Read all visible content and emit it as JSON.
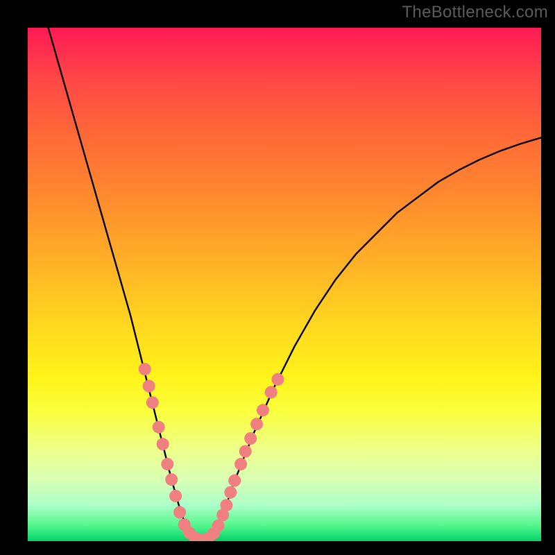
{
  "watermark": "TheBottleneck.com",
  "chart_data": {
    "type": "line",
    "title": "",
    "xlabel": "",
    "ylabel": "",
    "xlim": [
      0,
      100
    ],
    "ylim": [
      0,
      100
    ],
    "annotations": [],
    "series": [
      {
        "name": "bottleneck-curve",
        "x": [
          4,
          6,
          8,
          10,
          12,
          14,
          16,
          18,
          20,
          22,
          24,
          26,
          28,
          30,
          32,
          34,
          36,
          38,
          40,
          44,
          48,
          52,
          56,
          60,
          64,
          68,
          72,
          76,
          80,
          84,
          88,
          92,
          96,
          100
        ],
        "y": [
          100,
          93,
          86,
          79,
          72,
          65,
          58,
          51,
          44,
          36,
          28,
          20,
          12,
          5,
          1,
          0,
          1,
          5,
          11,
          21,
          30,
          38,
          45,
          51,
          56,
          60,
          64,
          67,
          70,
          72.3,
          74.3,
          76,
          77.4,
          78.6
        ]
      }
    ],
    "markers": {
      "name": "highlight-dots",
      "color": "#f08080",
      "points": [
        {
          "x": 22.8,
          "y": 33.5
        },
        {
          "x": 23.6,
          "y": 30.2
        },
        {
          "x": 24.3,
          "y": 27.0
        },
        {
          "x": 25.5,
          "y": 22.2
        },
        {
          "x": 26.3,
          "y": 18.9
        },
        {
          "x": 27.2,
          "y": 15.0
        },
        {
          "x": 28.0,
          "y": 12.0
        },
        {
          "x": 28.8,
          "y": 8.8
        },
        {
          "x": 29.6,
          "y": 5.6
        },
        {
          "x": 30.5,
          "y": 3.2
        },
        {
          "x": 31.5,
          "y": 1.6
        },
        {
          "x": 32.6,
          "y": 0.6
        },
        {
          "x": 33.9,
          "y": 0.2
        },
        {
          "x": 35.1,
          "y": 0.5
        },
        {
          "x": 36.2,
          "y": 1.5
        },
        {
          "x": 37.1,
          "y": 3.0
        },
        {
          "x": 38.0,
          "y": 5.1
        },
        {
          "x": 38.7,
          "y": 7.0
        },
        {
          "x": 39.5,
          "y": 9.5
        },
        {
          "x": 40.3,
          "y": 11.8
        },
        {
          "x": 41.5,
          "y": 15.0
        },
        {
          "x": 42.4,
          "y": 17.5
        },
        {
          "x": 43.4,
          "y": 20.0
        },
        {
          "x": 44.6,
          "y": 22.8
        },
        {
          "x": 45.8,
          "y": 25.5
        },
        {
          "x": 47.4,
          "y": 29.0
        },
        {
          "x": 48.7,
          "y": 31.5
        }
      ]
    },
    "gradient_stops": [
      {
        "pos": 0,
        "color": "#ff1a54"
      },
      {
        "pos": 10,
        "color": "#ff4747"
      },
      {
        "pos": 20,
        "color": "#ff6638"
      },
      {
        "pos": 33,
        "color": "#ff8a2e"
      },
      {
        "pos": 47,
        "color": "#ffb526"
      },
      {
        "pos": 58,
        "color": "#ffd81f"
      },
      {
        "pos": 68,
        "color": "#fff31a"
      },
      {
        "pos": 75,
        "color": "#f9ff3f"
      },
      {
        "pos": 82,
        "color": "#eeff88"
      },
      {
        "pos": 88,
        "color": "#d9ffb5"
      },
      {
        "pos": 93,
        "color": "#acffc8"
      },
      {
        "pos": 97,
        "color": "#53f68b"
      },
      {
        "pos": 100,
        "color": "#00d46a"
      }
    ]
  }
}
